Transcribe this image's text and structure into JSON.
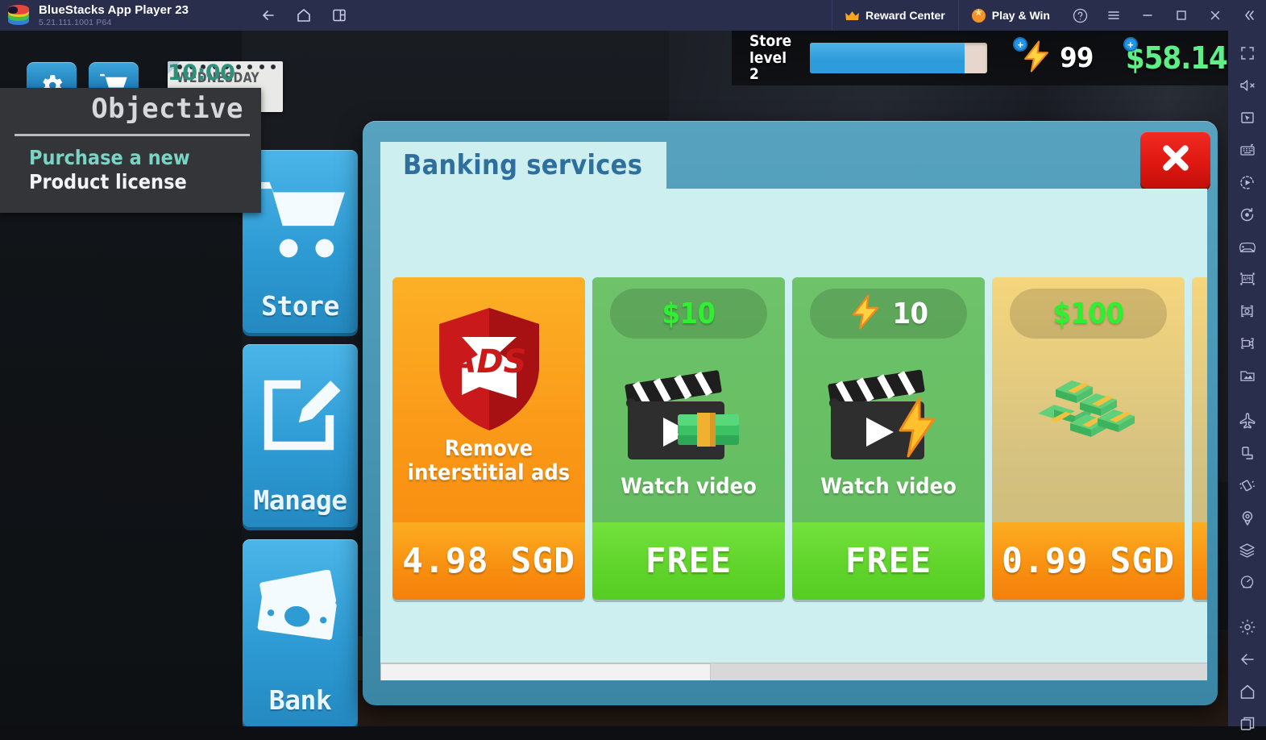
{
  "titlebar": {
    "app_title": "BlueStacks App Player 23",
    "version": "5.21.111.1001  P64",
    "logo_icon": "bluestacks-logo",
    "nav": [
      {
        "name": "back-icon",
        "label": "Back"
      },
      {
        "name": "home-icon",
        "label": "Home"
      },
      {
        "name": "multi-instance-icon",
        "label": "Instances"
      }
    ],
    "reward_center": "Reward Center",
    "play_and_win": "Play & Win",
    "help_label": "?",
    "window_buttons": [
      "menu-icon",
      "minimize-icon",
      "maximize-icon",
      "close-icon",
      "collapse-icon"
    ]
  },
  "game": {
    "top_buttons": [
      {
        "name": "settings-button",
        "icon": "gear-icon"
      },
      {
        "name": "shop-cart-button",
        "icon": "cart-icon"
      }
    ],
    "clock": {
      "day": "WEDNESDAY",
      "time": "10:00 PM"
    },
    "objective": {
      "title": "Objective",
      "highlight_text": "Purchase a new ",
      "normal_text": "Product license"
    },
    "sidebar": [
      {
        "name": "store",
        "label": "Store",
        "icon": "cart-icon"
      },
      {
        "name": "manage",
        "label": "Manage",
        "icon": "edit-square-icon"
      },
      {
        "name": "bank",
        "label": "Bank",
        "icon": "banknotes-icon"
      }
    ],
    "hud": {
      "level_label": "Store\nlevel 2",
      "xp_percent": 87,
      "energy_value": "99",
      "energy_icon": "lightning-icon",
      "money_value": "$58.14",
      "plus_label": "+"
    }
  },
  "dialog": {
    "title": "Banking services",
    "close_icon": "close-icon",
    "scroll_thumb_percent": 40,
    "cards": [
      {
        "name": "remove-interstitial-ads",
        "reward": "",
        "reward_color": "",
        "art": "ads-shield-icon",
        "caption": "Remove\ninterstitial ads",
        "price": "4.98 SGD",
        "theme": "orange"
      },
      {
        "name": "watch-video-money",
        "reward": "$10",
        "reward_color": "#2ef030",
        "art": "clapperboard-money-icon",
        "caption": "Watch video",
        "price": "FREE",
        "theme": "green"
      },
      {
        "name": "watch-video-energy",
        "reward": "10",
        "reward_color": "#ffffff",
        "reward_icon": "lightning-icon",
        "art": "clapperboard-lightning-icon",
        "caption": "Watch video",
        "price": "FREE",
        "theme": "green"
      },
      {
        "name": "buy-money-100",
        "reward": "$100",
        "reward_color": "#2ef030",
        "art": "cash-stacks-icon",
        "caption": "",
        "price": "0.99 SGD",
        "theme": "gold"
      }
    ]
  },
  "rail": {
    "icons": [
      "fullscreen-icon",
      "mute-icon",
      "cursor-screen-icon",
      "keymapping-icon",
      "macro-play-icon",
      "macro-record-icon",
      "gamepad-icon",
      "install-apk-icon",
      "screenshot-icon",
      "record-video-icon",
      "media-manager-icon",
      "airplane-icon",
      "rotate-portrait-icon",
      "shake-icon",
      "location-icon",
      "layers-icon",
      "performance-icon",
      "gear-icon",
      "back-icon",
      "home-icon",
      "multi-instance-icon"
    ]
  },
  "colors": {
    "titlebar_bg": "#2a2e4d",
    "accent_blue": "#2e9bd4",
    "money_green": "#5ef087",
    "dialog_blue": "#4896b4",
    "dialog_body": "#cdeff0",
    "close_red": "#e01812"
  }
}
